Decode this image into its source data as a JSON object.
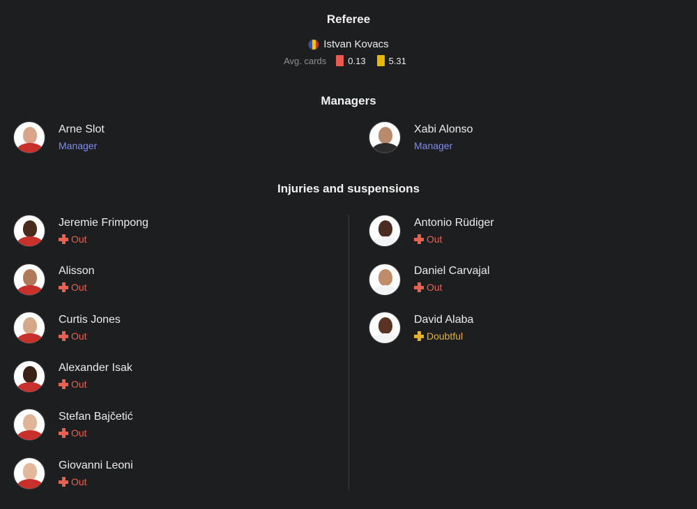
{
  "referee": {
    "title": "Referee",
    "name": "Istvan Kovacs",
    "flag_colors": [
      "#2b4fd1",
      "#f1c21b",
      "#d62828"
    ],
    "avg_label": "Avg. cards",
    "red_avg": "0.13",
    "yellow_avg": "5.31",
    "red_color": "#e85a4f",
    "yellow_color": "#e5b80b"
  },
  "managers": {
    "title": "Managers",
    "home": {
      "name": "Arne Slot",
      "role": "Manager"
    },
    "away": {
      "name": "Xabi Alonso",
      "role": "Manager"
    }
  },
  "injuries": {
    "title": "Injuries and suspensions",
    "status_colors": {
      "Out": "#e8614f",
      "Doubtful": "#e6b22a"
    },
    "home": [
      {
        "name": "Jeremie Frimpong",
        "status": "Out"
      },
      {
        "name": "Alisson",
        "status": "Out"
      },
      {
        "name": "Curtis Jones",
        "status": "Out"
      },
      {
        "name": "Alexander Isak",
        "status": "Out"
      },
      {
        "name": "Stefan Bajčetić",
        "status": "Out"
      },
      {
        "name": "Giovanni Leoni",
        "status": "Out"
      }
    ],
    "away": [
      {
        "name": "Antonio Rüdiger",
        "status": "Out"
      },
      {
        "name": "Daniel Carvajal",
        "status": "Out"
      },
      {
        "name": "David Alaba",
        "status": "Doubtful"
      }
    ]
  }
}
